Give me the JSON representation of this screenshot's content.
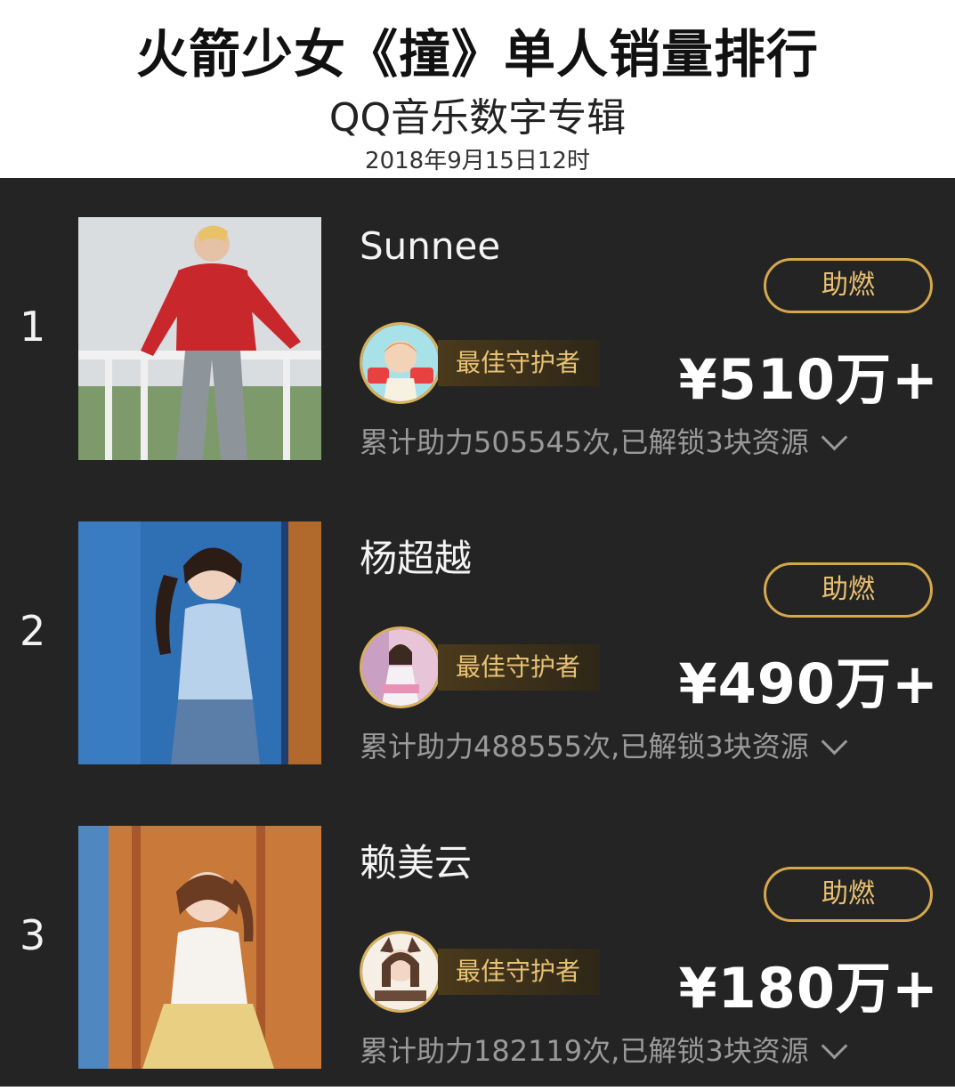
{
  "header": {
    "title": "火箭少女《撞》单人销量排行",
    "subtitle": "QQ音乐数字专辑",
    "timestamp": "2018年9月15日12时"
  },
  "colors": {
    "background": "#242424",
    "accent_gold": "#d5a84c",
    "text_light": "#f4f4f4",
    "text_muted": "#9a9a9a"
  },
  "ranking": [
    {
      "rank": "1",
      "name": "Sunnee",
      "boost_label": "助燃",
      "guardian_label": "最佳守护者",
      "amount": "¥510万+",
      "stats": "累计助力505545次,已解锁3块资源"
    },
    {
      "rank": "2",
      "name": "杨超越",
      "boost_label": "助燃",
      "guardian_label": "最佳守护者",
      "amount": "¥490万+",
      "stats": "累计助力488555次,已解锁3块资源"
    },
    {
      "rank": "3",
      "name": "赖美云",
      "boost_label": "助燃",
      "guardian_label": "最佳守护者",
      "amount": "¥180万+",
      "stats": "累计助力182119次,已解锁3块资源"
    }
  ]
}
